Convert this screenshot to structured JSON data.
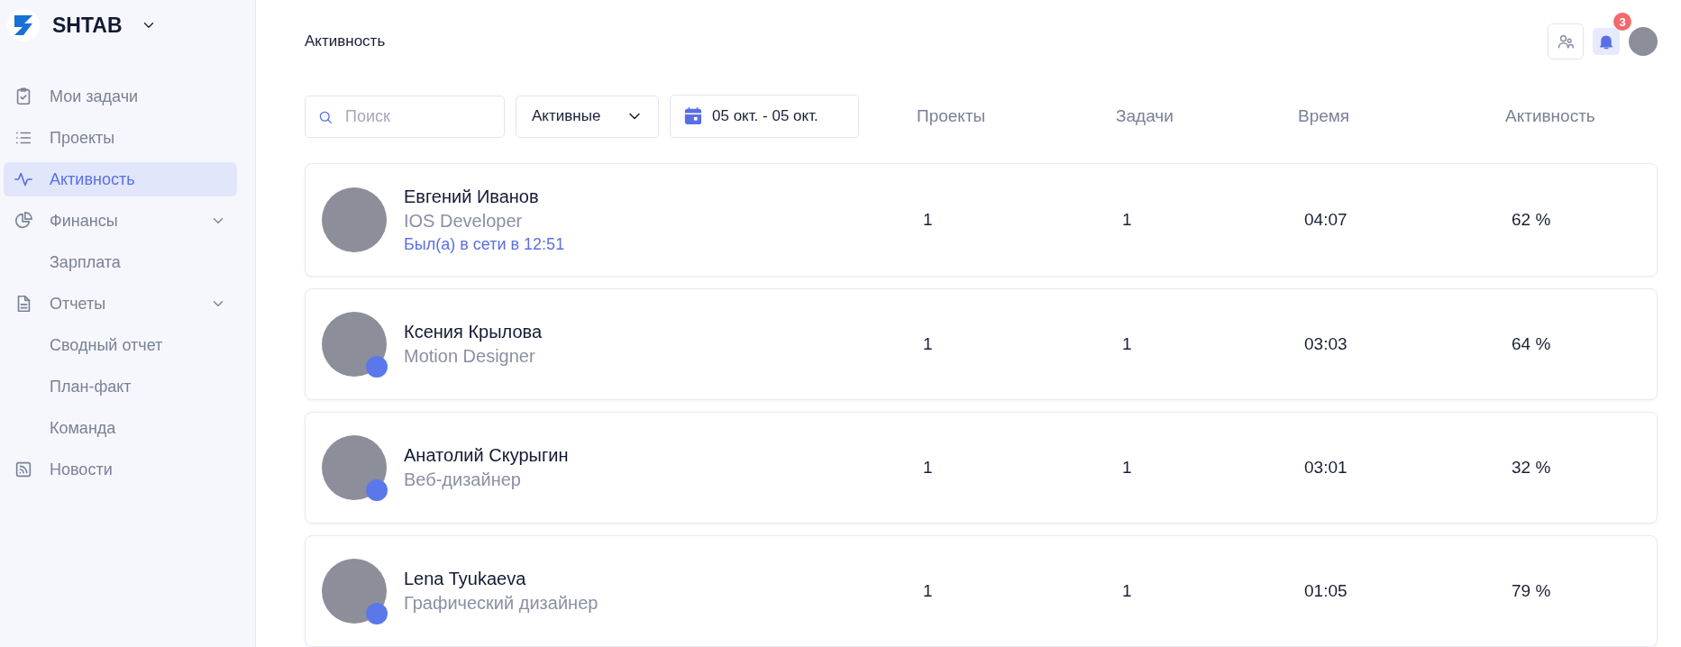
{
  "app": {
    "name": "SHTAB"
  },
  "sidebar": {
    "items": [
      {
        "label": "Мои задачи",
        "selected": false
      },
      {
        "label": "Проекты",
        "selected": false
      },
      {
        "label": "Активность",
        "selected": true
      },
      {
        "label": "Финансы",
        "selected": false,
        "expanded": true,
        "children": [
          {
            "label": "Зарплата",
            "selected": false
          }
        ]
      },
      {
        "label": "Отчеты",
        "selected": false,
        "expanded": true,
        "children": [
          {
            "label": "Сводный отчет",
            "selected": false
          },
          {
            "label": "План-факт",
            "selected": false
          },
          {
            "label": "Команда",
            "selected": false
          }
        ]
      },
      {
        "label": "Новости",
        "selected": false
      }
    ]
  },
  "header": {
    "title": "Активность",
    "notifications": "3"
  },
  "filters": {
    "search": {
      "placeholder": "Поиск"
    },
    "status": "Активные",
    "date_range": "05 окт. - 05 окт."
  },
  "table": {
    "columns": [
      "Проекты",
      "Задачи",
      "Время",
      "Активность"
    ],
    "rows": [
      {
        "name": "Евгений Иванов",
        "role": "IOS Developer",
        "last_seen": "Был(а) в сети в 12:51",
        "online": false,
        "projects": "1",
        "tasks": "1",
        "time": "04:07",
        "activity": "62 %"
      },
      {
        "name": "Ксения Крылова",
        "role": "Motion Designer",
        "online": true,
        "projects": "1",
        "tasks": "1",
        "time": "03:03",
        "activity": "64 %"
      },
      {
        "name": "Анатолий Скурыгин",
        "role": "Веб-дизайнер",
        "online": true,
        "projects": "1",
        "tasks": "1",
        "time": "03:01",
        "activity": "32 %"
      },
      {
        "name": "Lena Tyukaeva",
        "role": "Графический дизайнер",
        "online": true,
        "projects": "1",
        "tasks": "1",
        "time": "01:05",
        "activity": "79 %"
      }
    ]
  }
}
